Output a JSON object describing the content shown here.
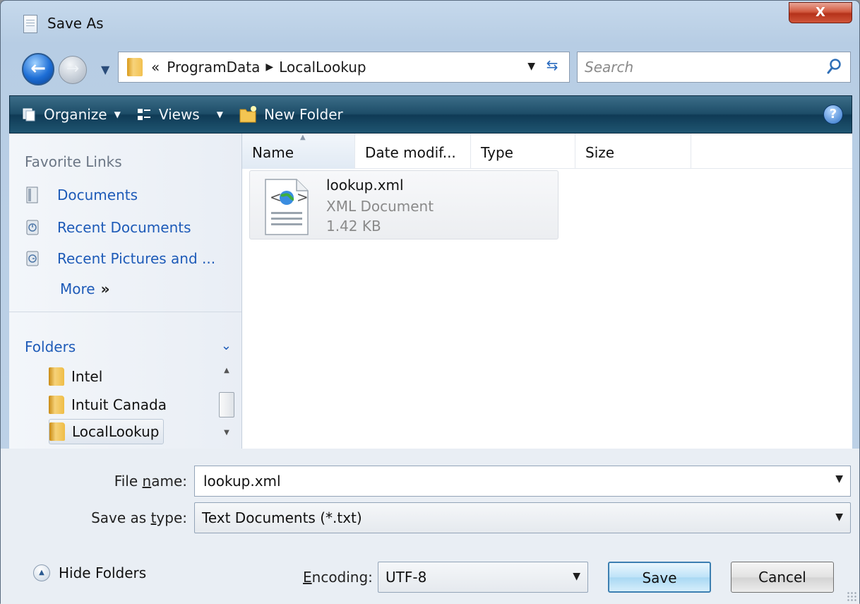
{
  "window": {
    "title": "Save As",
    "close_label": "X"
  },
  "address": {
    "overflow": "«",
    "path": [
      "ProgramData",
      "LocalLookup"
    ],
    "search_placeholder": "Search"
  },
  "toolbar": {
    "organize": "Organize",
    "views": "Views",
    "new_folder": "New Folder",
    "help": "?"
  },
  "favorites": {
    "title": "Favorite Links",
    "items": [
      {
        "label": "Documents",
        "icon": "documents-icon"
      },
      {
        "label": "Recent Documents",
        "icon": "recent-documents-icon"
      },
      {
        "label": "Recent Pictures and ...",
        "icon": "recent-pictures-icon"
      }
    ],
    "more": "More",
    "more_chevron": "»"
  },
  "folders": {
    "title": "Folders",
    "items": [
      {
        "label": "Intel"
      },
      {
        "label": "Intuit Canada"
      },
      {
        "label": "LocalLookup",
        "selected": true
      }
    ]
  },
  "columns": [
    "Name",
    "Date modif...",
    "Type",
    "Size"
  ],
  "files": [
    {
      "name": "lookup.xml",
      "type": "XML Document",
      "size": "1.42 KB",
      "icon": "xml-file-icon"
    }
  ],
  "form": {
    "filename_label_pre": "File ",
    "filename_label_u": "n",
    "filename_label_post": "ame:",
    "filename_value": "lookup.xml",
    "type_label_pre": "Save as ",
    "type_label_u": "t",
    "type_label_post": "ype:",
    "type_value": "Text Documents (*.txt)",
    "hide_folders": "Hide Folders",
    "encoding_label_u": "E",
    "encoding_label_post": "ncoding:",
    "encoding_value": "UTF-8",
    "save": "Save",
    "cancel": "Cancel"
  },
  "colors": {
    "toolbar": "#1d4d68",
    "link": "#1e5bb8",
    "save_border": "#3c7fb1"
  }
}
